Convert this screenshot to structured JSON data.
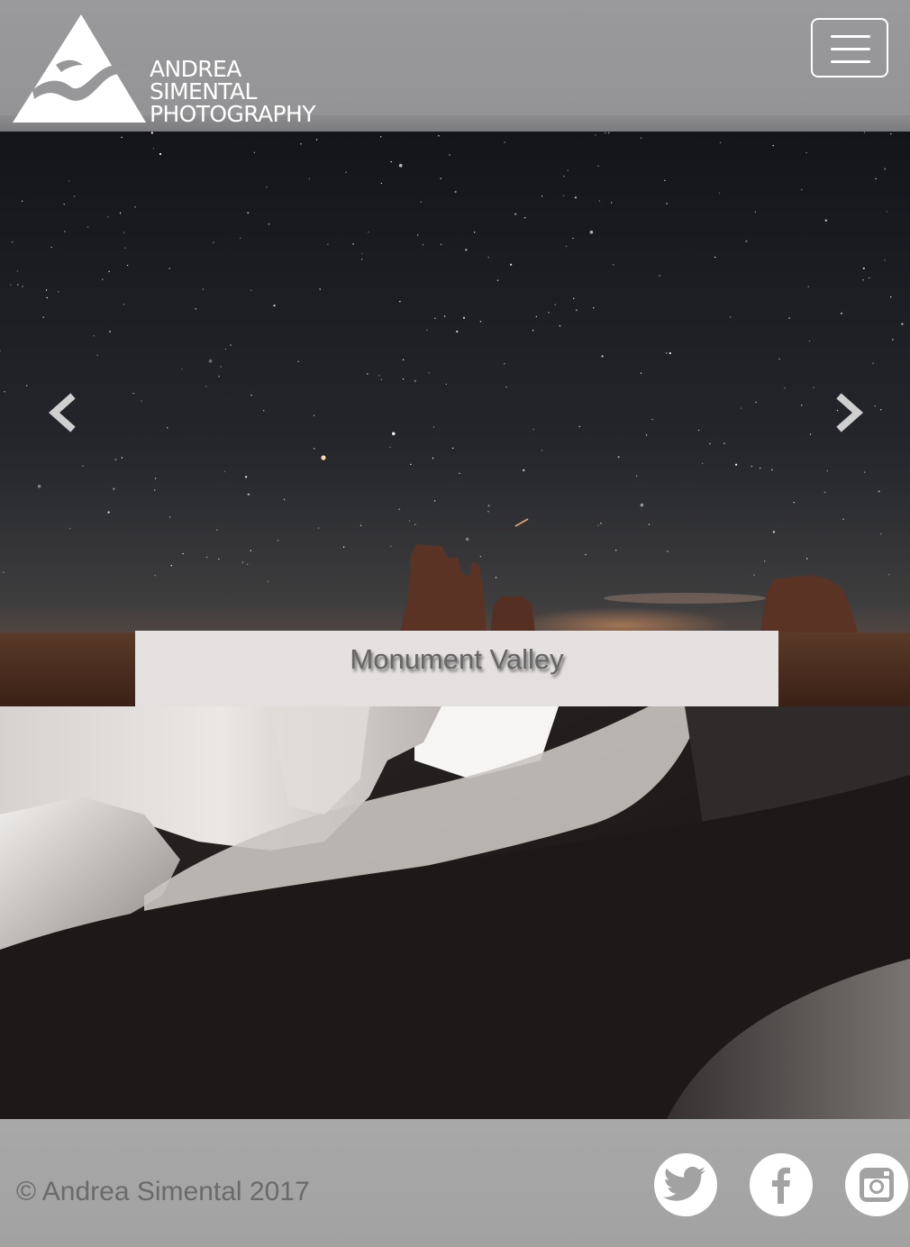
{
  "brand": {
    "name_lines": [
      "ANDREA",
      "SIMENTAL",
      "PHOTOGRAPHY"
    ],
    "logo_icon": "mountain-logo-icon"
  },
  "header": {
    "menu_icon": "hamburger-menu-icon"
  },
  "carousel": {
    "caption": "Monument Valley",
    "prev_icon": "chevron-left-icon",
    "next_icon": "chevron-right-icon"
  },
  "footer": {
    "copyright": "© Andrea Simental 2017",
    "social": [
      {
        "name": "twitter-icon"
      },
      {
        "name": "facebook-icon"
      },
      {
        "name": "instagram-icon"
      }
    ]
  },
  "colors": {
    "header_bg": "#989899",
    "footer_bg": "#a6a6a6",
    "caption_bg": "#eeecec",
    "caption_text": "#666666",
    "footer_text": "#6a6a6a"
  }
}
